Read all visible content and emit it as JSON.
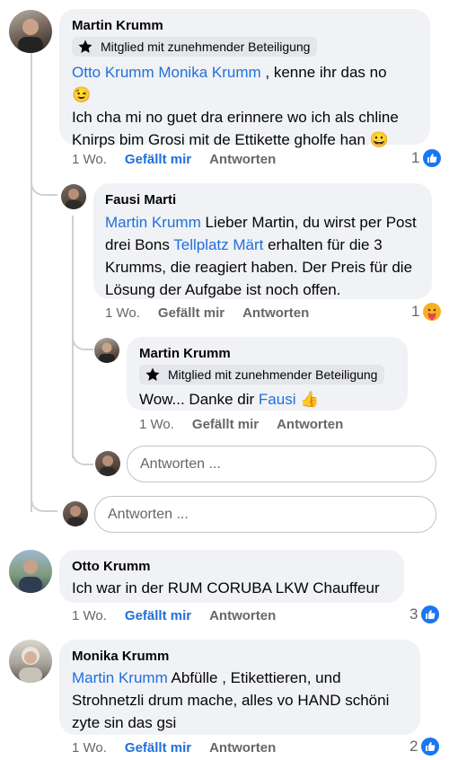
{
  "badge_label": "Mitglied mit zunehmender Beteiligung",
  "comments": [
    {
      "author": "Martin Krumm",
      "mentions": "Otto Krumm Monika Krumm",
      "text1": " , kenne ihr das no",
      "emoji1": "😉",
      "text2": "Ich cha mi no guet dra erinnere wo ich als chline Knirps bim Grosi mit de Ettikette gholfe han 😀",
      "time": "1 Wo.",
      "like": "Gefällt mir",
      "reply": "Antworten",
      "reaction_count": "1"
    },
    {
      "author": "Fausi Marti",
      "mention1": "Martin Krumm",
      "text1": " Lieber Martin, du wirst per Post drei Bons ",
      "mention2": "Tellplatz Märt",
      "text2": " erhalten für die 3 Krumms, die reagiert haben. Der Preis für die Lösung der Aufgabe ist noch offen.",
      "time": "1 Wo.",
      "like": "Gefällt mir",
      "reply": "Antworten",
      "reaction_count": "1"
    },
    {
      "author": "Martin Krumm",
      "text1": "Wow... Danke dir ",
      "mention": "Fausi",
      "emoji": "👍",
      "time": "1 Wo.",
      "like": "Gefällt mir",
      "reply": "Antworten"
    },
    {
      "author": "Otto Krumm",
      "text": "Ich war in der RUM CORUBA LKW Chauffeur",
      "time": "1 Wo.",
      "like": "Gefällt mir",
      "reply": "Antworten",
      "reaction_count": "3"
    },
    {
      "author": "Monika Krumm",
      "mention": "Martin Krumm",
      "text": " Abfülle , Etikettieren, und Strohnetzli drum mache, alles vo HAND schöni zyte sin das gsi",
      "time": "1 Wo.",
      "like": "Gefällt mir",
      "reply": "Antworten",
      "reaction_count": "2"
    }
  ],
  "reply_inputs": {
    "nested_placeholder": "Antworten ...",
    "thread_placeholder": "Antworten ..."
  },
  "colors": {
    "link": "#216fdb",
    "bubble": "#f0f2f5",
    "like": "#1877f2"
  },
  "icons": {
    "badge": "star-badge-icon",
    "reaction_like": "thumbs-up-reaction-icon",
    "reaction_care": "care-reaction-icon"
  }
}
